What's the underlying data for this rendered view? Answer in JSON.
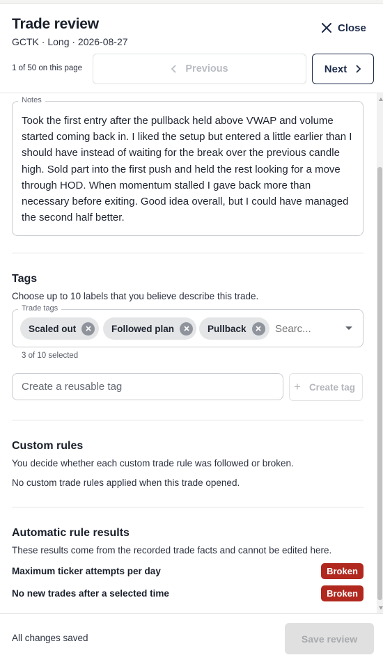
{
  "header": {
    "title": "Trade review",
    "subtitle": "GCTK · Long · 2026-08-27",
    "close_label": "Close",
    "pager_text": "1 of 50 on this page",
    "previous_label": "Previous",
    "next_label": "Next"
  },
  "notes": {
    "legend": "Notes",
    "text": "Took the first entry after the pullback held above VWAP and volume started coming back in. I liked the setup but entered a little earlier than I should have instead of waiting for the break over the previous candle high. Sold part into the first push and held the rest looking for a move through HOD. When momentum stalled I gave back more than necessary before exiting. Good idea overall, but I could have managed the second half better."
  },
  "tags": {
    "title": "Tags",
    "description": "Choose up to 10 labels that you believe describe this trade.",
    "legend": "Trade tags",
    "selected": [
      "Scaled out",
      "Followed plan",
      "Pullback"
    ],
    "search_placeholder": "Searc...",
    "count_text": "3 of 10 selected",
    "create_placeholder": "Create a reusable tag",
    "create_button_label": "Create tag"
  },
  "custom_rules": {
    "title": "Custom rules",
    "description": "You decide whether each custom trade rule was followed or broken.",
    "empty_text": "No custom trade rules applied when this trade opened."
  },
  "automatic_rules": {
    "title": "Automatic rule results",
    "description": "These results come from the recorded trade facts and cannot be edited here.",
    "items": [
      {
        "name": "Maximum ticker attempts per day",
        "status": "Broken"
      },
      {
        "name": "No new trades after a selected time",
        "status": "Broken"
      }
    ]
  },
  "footer": {
    "status": "All changes saved",
    "save_label": "Save review"
  },
  "colors": {
    "accent": "#1c2a4a",
    "broken": "#b1281e"
  }
}
